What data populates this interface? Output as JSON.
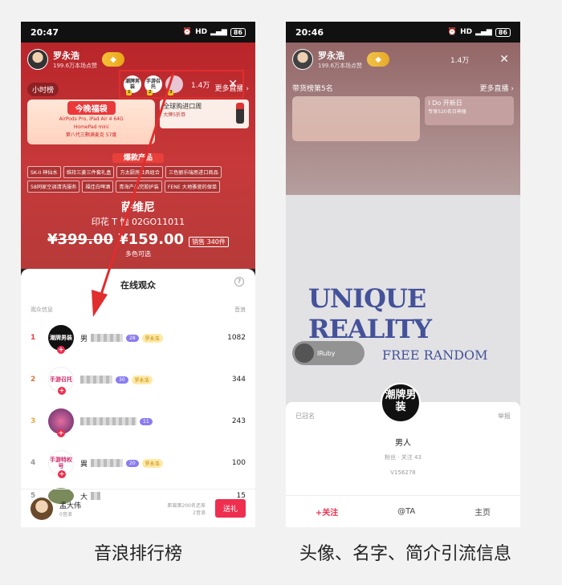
{
  "left_phone": {
    "status": {
      "time": "20:47",
      "net": "HD",
      "battery": "86"
    },
    "host": {
      "name": "罗永浩",
      "sub": "199.6万本场点赞"
    },
    "viewers": [
      {
        "label": "潮牌男装",
        "tag": "1"
      },
      {
        "label": "手游召托",
        "tag": "2"
      },
      {
        "label": "",
        "tag": "3"
      }
    ],
    "viewer_count": "1.4万",
    "close_symbol": "✕",
    "hour_rank": "小时榜",
    "more_live": "更多直播 ›",
    "banner": {
      "title": "今晚福袋",
      "line1": "AirPods Pro, iPad Air 4 64G",
      "line2": "HomePad mini",
      "line3": "第八代三颗满麦克 57度"
    },
    "side_banner": {
      "title": "全球购进口周",
      "sub": "大牌5折券"
    },
    "hot_label": "爆款产品",
    "chips": [
      "SK-II 神仙水",
      "维持三菱三件套礼盒",
      "方太厨房灶具组合",
      "三色丽乐瑞思进口商品",
      "58同家空调清洗服务",
      "福佳白啤酒",
      "青海产品完胶护装",
      "FENE 大地雅瓷的保单"
    ],
    "product": {
      "line1": "萨维尼",
      "line2": "印花 T 恤 02GO11011",
      "old_price": "¥399.00",
      "new_price": "¥159.00",
      "sold": "销售 340件",
      "multi": "多色可选"
    },
    "panel": {
      "title": "在线观众",
      "help": "?",
      "col_left": "观众信息",
      "col_right": "音浪",
      "rows": [
        {
          "rank": "1",
          "avatar": "潮牌男装",
          "name": "男",
          "level": "28",
          "fan": "罗永浩",
          "score": "1082"
        },
        {
          "rank": "2",
          "avatar": "手游召托",
          "name": "",
          "level": "30",
          "fan": "罗永浩",
          "score": "344"
        },
        {
          "rank": "3",
          "avatar": "",
          "name": "",
          "level": "11",
          "fan": "",
          "score": "243"
        },
        {
          "rank": "4",
          "avatar": "手游特权号",
          "name": "異",
          "level": "20",
          "fan": "罗永浩",
          "score": "100"
        },
        {
          "rank": "5",
          "avatar": "",
          "name": "大",
          "level": "",
          "fan": "",
          "score": "15"
        }
      ],
      "footer": {
        "name": "孟大伟",
        "sub": "0音浪",
        "distance": "距离第200名还差",
        "distance_value": "2音浪",
        "gift": "送礼"
      }
    }
  },
  "right_phone": {
    "status": {
      "time": "20:46",
      "net": "HD",
      "battery": "86"
    },
    "host": {
      "name": "罗永浩",
      "sub": "199.6万本场点赞"
    },
    "viewer_count": "1.4万",
    "rank_text": "带货榜第5名",
    "more_live": "更多直播 ›",
    "side_banner": {
      "title": "I Do 开新日",
      "sub": "专享520名日神器"
    },
    "shirt": {
      "main": "UNIQUE REALITY",
      "sub": "FREE RANDOM"
    },
    "user_chip": "IRuby",
    "profile": {
      "avatar_text": "潮牌男装",
      "crown": "已冠名",
      "report": "举报",
      "name": "男人",
      "stats": "粉丝 · 关注 43",
      "id": "V156278",
      "follow": "+关注",
      "at": "@TA",
      "home": "主页"
    }
  },
  "captions": {
    "left": "音浪排行榜",
    "right": "头像、名字、简介引流信息"
  },
  "colors": {
    "accent": "#ee2f4f",
    "highlight_box": "#e02d2d",
    "live_bg": "#c7393a"
  }
}
